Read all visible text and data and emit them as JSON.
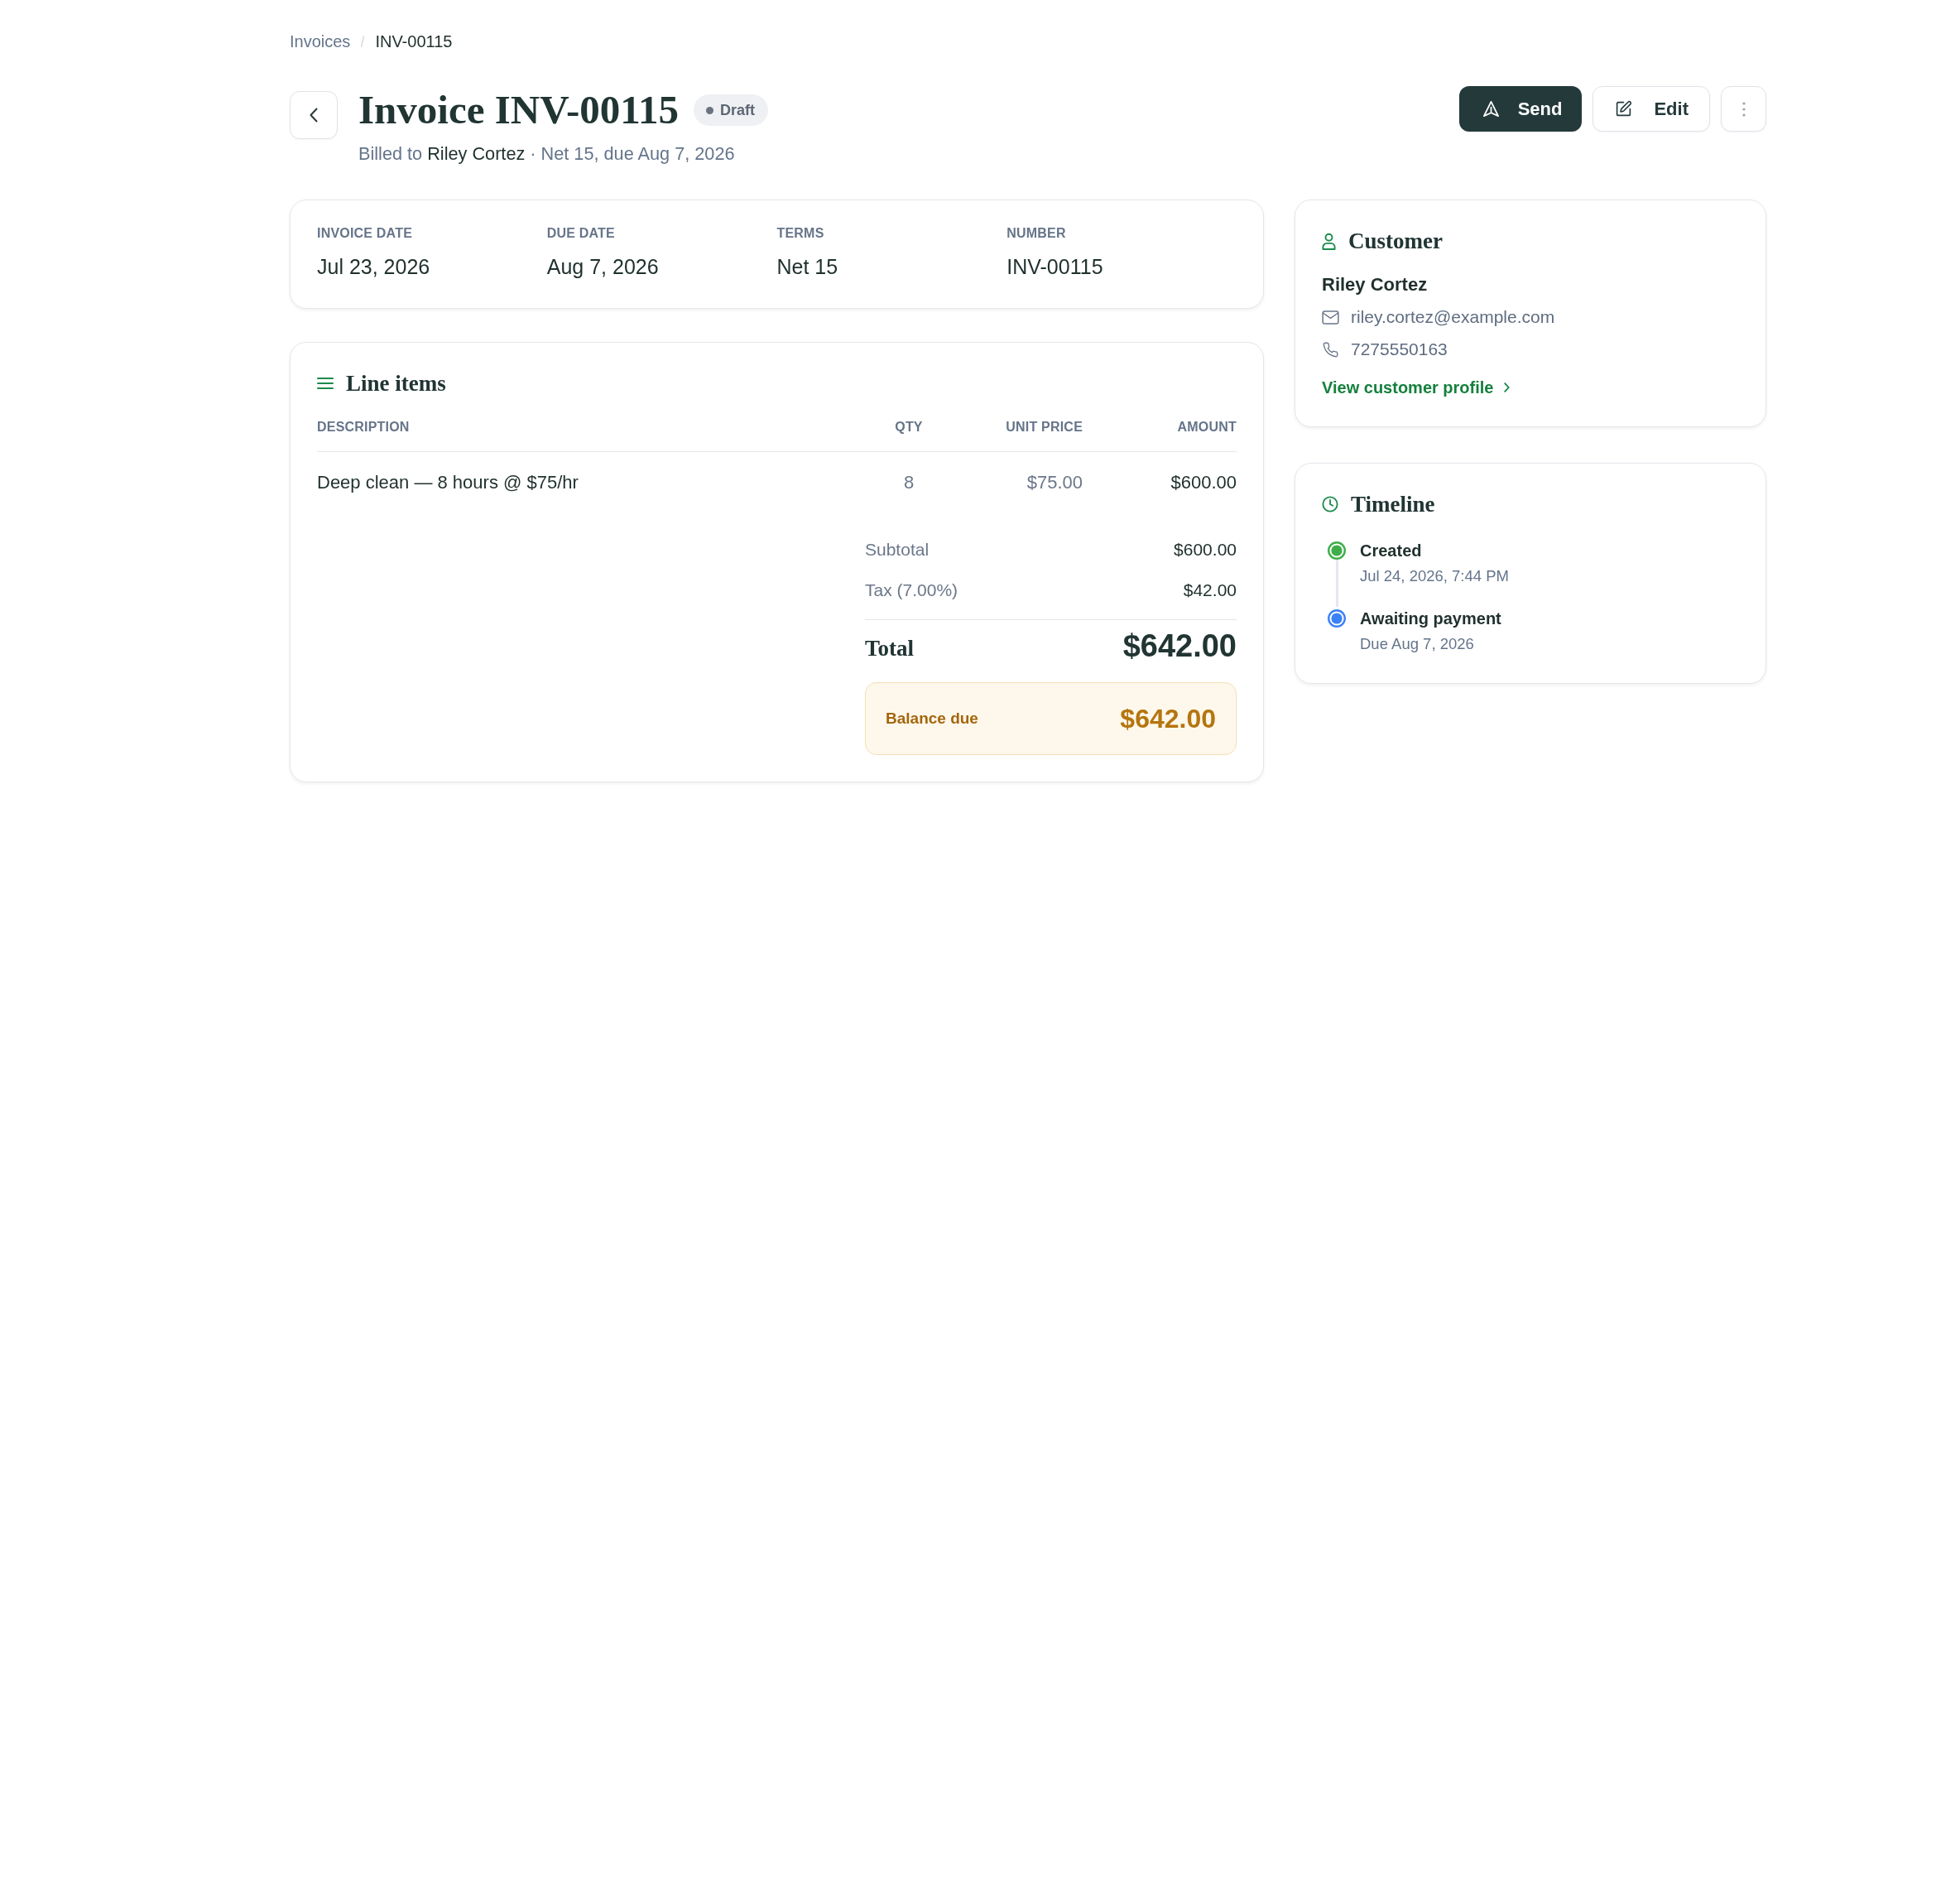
{
  "breadcrumb": [
    {
      "label": "Invoices",
      "current": false
    },
    {
      "label": "INV-00115",
      "current": true
    }
  ],
  "header": {
    "title": "Invoice INV-00115",
    "status": "Draft",
    "subtitle": "Billed to **Riley Cortez** · Net 15, due Aug 7, 2026"
  },
  "actions": [
    {
      "kind": "primary",
      "label": "Send"
    },
    {
      "kind": "secondary",
      "label": "Edit"
    },
    {
      "kind": "more"
    }
  ],
  "summary": [
    {
      "label": "INVOICE DATE",
      "value": "Jul 23, 2026"
    },
    {
      "label": "DUE DATE",
      "value": "Aug 7, 2026"
    },
    {
      "label": "TERMS",
      "value": "Net 15"
    },
    {
      "label": "NUMBER",
      "value": "INV-00115"
    }
  ],
  "line_items": {
    "title": "Line items",
    "columns": [
      "DESCRIPTION",
      "QTY",
      "UNIT PRICE",
      "AMOUNT"
    ],
    "rows": [
      {
        "description": "Deep clean — 8 hours @ $75/hr",
        "qty": "8",
        "unit_price": "$75.00",
        "amount": "$600.00"
      }
    ],
    "totals": [
      {
        "label": "Subtotal",
        "value": "$600.00"
      },
      {
        "label": "Tax (7.00%)",
        "value": "$42.00"
      }
    ],
    "total": {
      "label": "Total",
      "value": "$642.00"
    },
    "balance_due": {
      "label": "Balance due",
      "value": "$642.00"
    }
  },
  "customer": {
    "title": "Customer",
    "name": "Riley Cortez",
    "email": "riley.cortez@example.com",
    "phone": "7275550163",
    "link": "View customer profile"
  },
  "timeline": {
    "title": "Timeline",
    "events": [
      {
        "title": "Created",
        "detail": "Jul 24, 2026, 7:44 PM",
        "color": "#3fae4a"
      },
      {
        "title": "Awaiting payment",
        "detail": "Due Aug 7, 2026",
        "color": "#3b82f6"
      }
    ]
  }
}
